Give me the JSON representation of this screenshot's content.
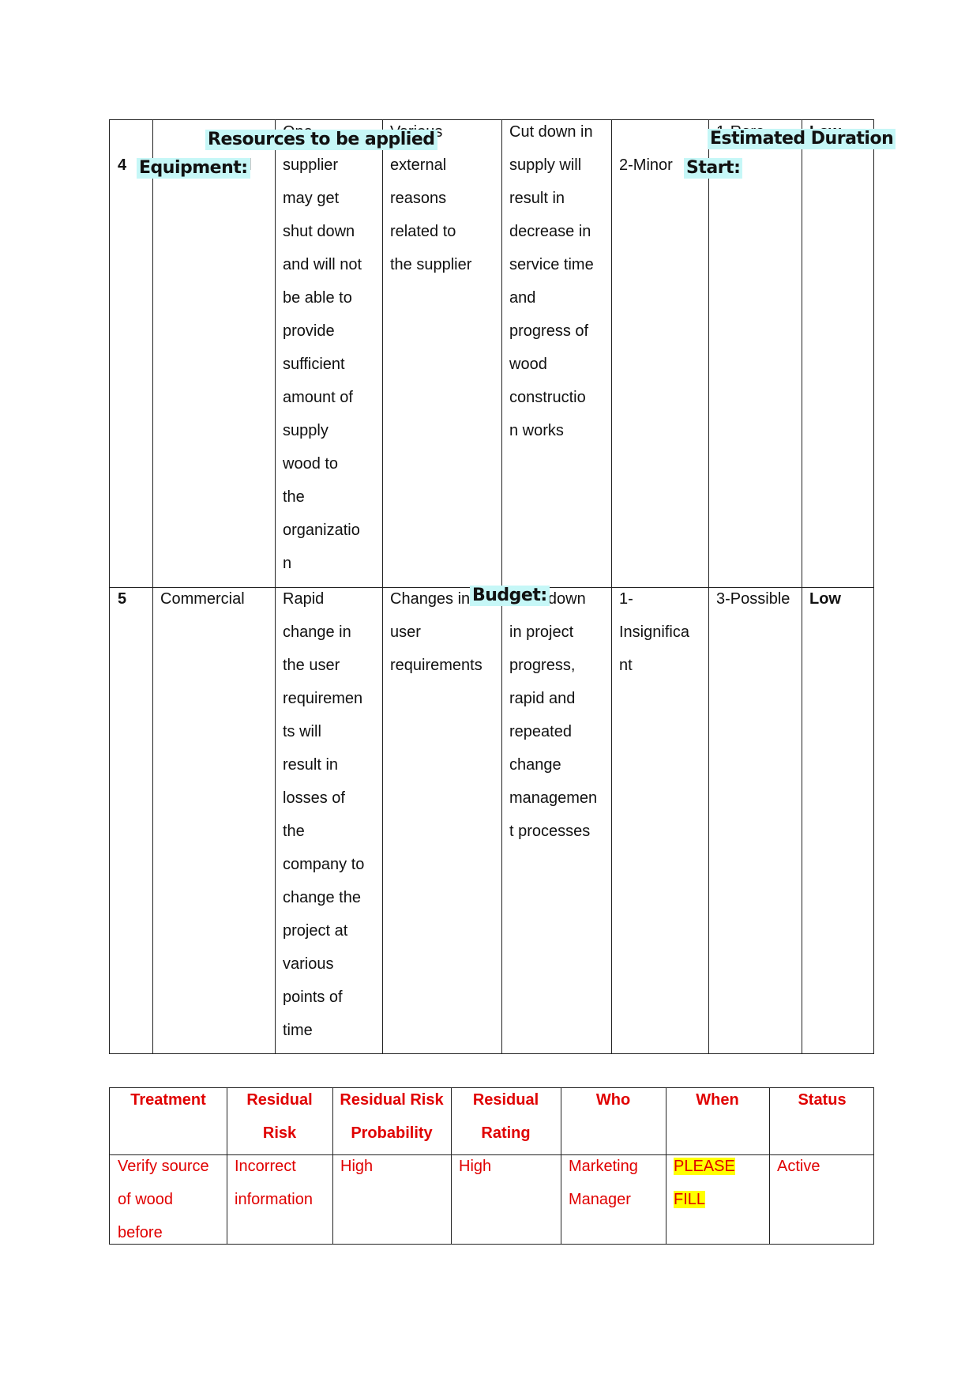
{
  "risk_table": {
    "rows": [
      {
        "no": "\n4",
        "category": "\nal",
        "risk": "One\nsupplier\nmay get\nshut down\nand will not\nbe able to\nprovide\nsufficient\namount of\nsupply\nwood to\nthe\norganizatio\nn",
        "cause": "Various\nexternal\nreasons\nrelated to\nthe supplier",
        "impact": "Cut down in\nsupply will\nresult in\ndecrease in\nservice time\nand\nprogress of\nwood\nconstructio\nn works",
        "consequence": "\n2-Minor",
        "likelihood": "1-Rare",
        "rating": "Low"
      },
      {
        "no": "5",
        "category": "Commercial",
        "risk": "Rapid\nchange in\nthe user\nrequiremen\nts will\nresult in\nlosses of\nthe\ncompany to\nchange the\nproject at\nvarious\npoints of\ntime",
        "cause": "Changes in\nuser\nrequirements",
        "impact": "Slow down\nin project\nprogress,\nrapid and\nrepeated\nchange\nmanagemen\nt processes",
        "consequence": "1-\nInsignifica\nnt",
        "likelihood": "3-Possible",
        "rating": "Low"
      }
    ]
  },
  "treatment_table": {
    "headers": [
      "Treatment",
      "Residual\nRisk",
      "Residual Risk\nProbability",
      "Residual\nRating",
      "Who",
      "When",
      "Status"
    ],
    "row": [
      "Verify source\nof wood\nbefore",
      "Incorrect\ninformation",
      "High",
      "High",
      "Marketing\nManager",
      "PLEASE FILL",
      "Active"
    ],
    "text_color": "#e00000",
    "highlight_color": "#ffff00"
  },
  "overlays": {
    "resources": "Resources to be applied",
    "equipment": "Equipment:",
    "estimated_duration": "Estimated Duration",
    "start": "Start:",
    "budget": "Budget:",
    "color": "#c6f7f7"
  }
}
